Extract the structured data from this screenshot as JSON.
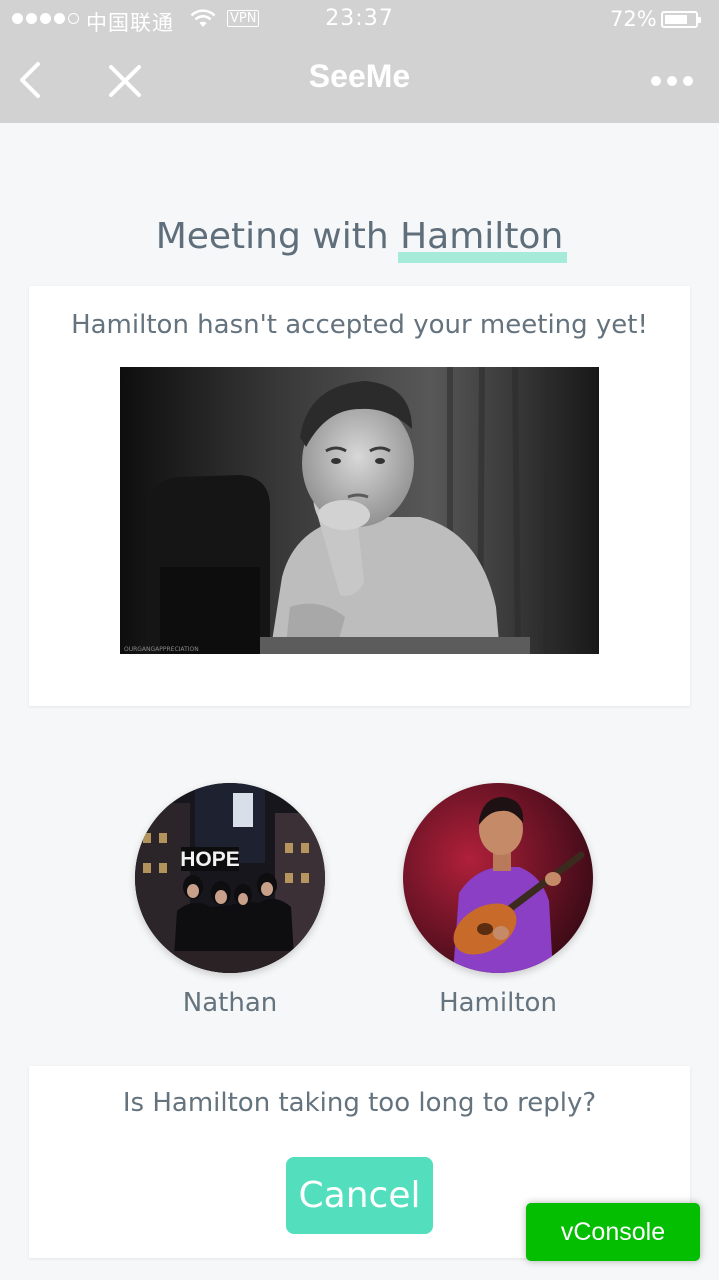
{
  "status_bar": {
    "carrier": "中国联通",
    "vpn_label": "VPN",
    "time": "23:37",
    "battery_percent": "72%",
    "battery_level": 0.72,
    "signal_bars_filled": 4,
    "signal_bars_total": 5
  },
  "nav": {
    "title": "SeeMe",
    "back_icon": "chevron-left-icon",
    "close_icon": "close-icon",
    "more_icon": "more-horizontal-icon"
  },
  "page": {
    "heading_prefix": "Meeting with ",
    "heading_name": "Hamilton"
  },
  "notice_card": {
    "message": "Hamilton hasn't accepted your meeting yet!",
    "gif_caption": "OURGANGAPPRECIATION"
  },
  "participants": [
    {
      "name": "Nathan",
      "sign_text": "HOPE"
    },
    {
      "name": "Hamilton"
    }
  ],
  "reply_card": {
    "question": "Is Hamilton taking too long to reply?",
    "cancel_label": "Cancel"
  },
  "vconsole_label": "vConsole",
  "colors": {
    "nav_bg": "#d2d2d2",
    "accent": "#53dfbe",
    "highlight": "#a6ebd9",
    "text": "#64737e",
    "vconsole": "#04be02"
  }
}
